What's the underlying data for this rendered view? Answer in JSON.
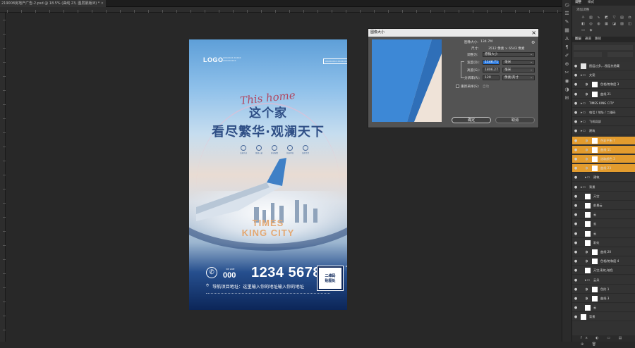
{
  "document_tab": {
    "title": "219008房地产广告-2.psd @ 18.5% (曲线 23, 图层蒙版/8) *",
    "close_glyph": "×"
  },
  "poster": {
    "logo": "LOGO",
    "logo_sub": "XXXXXXX XXXXX XXXXXXXXX",
    "tag": "XXXXXXXX XXXXXXXX",
    "script": "This home",
    "title_line1": "这个家",
    "title_line2": "看尽繁华·观澜天下",
    "features": [
      "交通大道",
      "便捷入童",
      "商业配套",
      "花园环境",
      "品质生活"
    ],
    "brand_line1": "TIMES",
    "brand_line2": "KING CITY",
    "vip_label": "VIP LINE",
    "area_code": "000",
    "phone": "1234 5678",
    "address": "导航项目地址：这里输入你的地址输入你的地址",
    "qr_text": "二维码\n贴图处",
    "qr_plus": "+"
  },
  "dialog": {
    "title": "图像大小",
    "close": "×",
    "image_size_label": "图像大小:",
    "image_size_value": "134.7M",
    "dims_label": "尺寸:",
    "dims_value": "3512 像素 × 6543 像素",
    "fit_label": "调整为:",
    "fit_value": "原稿大小",
    "width_label": "宽度(D):",
    "width_value": "1146.71",
    "width_unit": "毫米",
    "height_label": "高度(G):",
    "height_value": "1806.27",
    "height_unit": "毫米",
    "res_label": "分辨率(R):",
    "res_value": "120",
    "res_unit": "像素/英寸",
    "resample_label": "重新采样(S):",
    "resample_value": "自动",
    "ok": "确定",
    "cancel": "取消"
  },
  "panels": {
    "top_tabs": [
      "调整",
      "样式"
    ],
    "adjust_hint": "添加调整",
    "layer_tabs": [
      "图层",
      "通道",
      "路径"
    ]
  },
  "layers": [
    {
      "name": "图层过多,...图层先隐藏",
      "indent": 0,
      "type": "text",
      "sel": false
    },
    {
      "name": "文案",
      "indent": 0,
      "type": "group",
      "sel": false
    },
    {
      "name": "色相/饱和度 3",
      "indent": 1,
      "type": "adj",
      "sel": false
    },
    {
      "name": "曲线 21",
      "indent": 1,
      "type": "adj",
      "sel": false
    },
    {
      "name": "TIMES KING CITY",
      "indent": 0,
      "type": "group",
      "sel": false
    },
    {
      "name": "电话 / 地址 / 二维码",
      "indent": 0,
      "type": "group",
      "sel": false
    },
    {
      "name": "飞机局部",
      "indent": 0,
      "type": "group",
      "sel": false
    },
    {
      "name": "建筑",
      "indent": 0,
      "type": "group",
      "sel": false
    },
    {
      "name": "色彩平衡 7",
      "indent": 1,
      "type": "adj",
      "sel": true
    },
    {
      "name": "曲线 11",
      "indent": 1,
      "type": "adj",
      "sel": true
    },
    {
      "name": "选取颜色 3",
      "indent": 1,
      "type": "adj",
      "sel": true
    },
    {
      "name": "曲线 23",
      "indent": 1,
      "type": "adj",
      "sel": true
    },
    {
      "name": "建筑",
      "indent": 1,
      "type": "group",
      "sel": false
    },
    {
      "name": "背景",
      "indent": 0,
      "type": "group",
      "sel": false
    },
    {
      "name": "天空",
      "indent": 1,
      "type": "img",
      "sel": false
    },
    {
      "name": "前景云",
      "indent": 1,
      "type": "img",
      "sel": false
    },
    {
      "name": "云",
      "indent": 1,
      "type": "img",
      "sel": false
    },
    {
      "name": "云",
      "indent": 1,
      "type": "img",
      "sel": false
    },
    {
      "name": "云",
      "indent": 1,
      "type": "img",
      "sel": false
    },
    {
      "name": "彩虹",
      "indent": 1,
      "type": "img",
      "sel": false
    },
    {
      "name": "曲线 20",
      "indent": 1,
      "type": "adj",
      "sel": false
    },
    {
      "name": "色相/饱和度 4",
      "indent": 1,
      "type": "adj",
      "sel": false
    },
    {
      "name": "天空,彩虹,暗色",
      "indent": 1,
      "type": "img",
      "sel": false
    },
    {
      "name": "云朵",
      "indent": 1,
      "type": "group",
      "sel": false
    },
    {
      "name": "色阶 1",
      "indent": 1,
      "type": "adj",
      "sel": false
    },
    {
      "name": "曲线 3",
      "indent": 1,
      "type": "adj",
      "sel": false
    },
    {
      "name": "云",
      "indent": 1,
      "type": "img",
      "sel": false
    },
    {
      "name": "背景",
      "indent": 0,
      "type": "img",
      "sel": false
    }
  ],
  "panel_bottom_icons": "fx ◐ ▭ ▤ ⊕ 🗑",
  "colors": {
    "selected_layer": "#e39c2e",
    "dialog_bg": "#535353",
    "poster_navy": "#0c2659",
    "brand_gold": "#e3a873"
  }
}
